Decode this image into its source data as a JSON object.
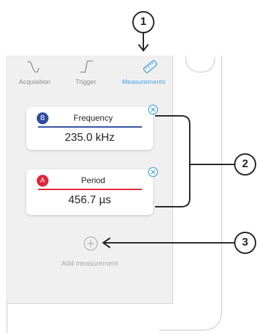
{
  "tabs": [
    {
      "label": "Acquisition",
      "icon": "sine-wave-icon"
    },
    {
      "label": "Trigger",
      "icon": "trigger-edge-icon"
    },
    {
      "label": "Measurements",
      "icon": "ruler-icon"
    }
  ],
  "measurements": [
    {
      "channel": "B",
      "name": "Frequency",
      "value": "235.0 kHz",
      "color": "#2f4aa0"
    },
    {
      "channel": "A",
      "name": "Period",
      "value": "456.7 µs",
      "color": "#e0263a"
    }
  ],
  "add_label": "Add measurement",
  "callouts": [
    "1",
    "2",
    "3"
  ],
  "colors": {
    "accent": "#4aa3e0",
    "channel_a": "#e0263a",
    "channel_b": "#2f4aa0",
    "panel": "#f0f0f1"
  }
}
